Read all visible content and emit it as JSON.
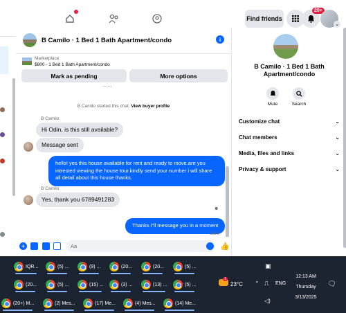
{
  "topnav": {
    "icons": [
      "home-icon",
      "friends-icon",
      "groups-icon"
    ],
    "find_friends": "Find friends",
    "notifications_badge": "20+"
  },
  "chat": {
    "title": "B Camilo · 1 Bed 1 Bath Apartment/condo",
    "marketplace": {
      "label": "Marketplace",
      "listing": "$800 - 1 Bed 1 Bath Apartment/condo",
      "mark_pending": "Mark as pending",
      "more_options": "More options"
    },
    "cut_off_text": "... ...",
    "system_line": "B Camilo started this chat.",
    "system_link": "View buyer profile",
    "messages": [
      {
        "sender": "B Camilo",
        "text": "Hi Odin, is this still available?"
      },
      {
        "sender": "",
        "text": "Message sent"
      },
      {
        "sender": "me",
        "text": "hello! yes this house available for rent and ready to move.are you intrested viewing the house tour.kindly send your number i will share all detail about this house thanks."
      },
      {
        "sender": "B Camilo",
        "text": "Yes, thank you 6789491283"
      },
      {
        "sender": "me",
        "text": "Thanks i\"ll message you in a moment"
      }
    ],
    "sent_status": "Sent",
    "composer_placeholder": "Aa"
  },
  "right_panel": {
    "title_line1": "B Camilo · 1 Bed 1 Bath",
    "title_line2": "Apartment/condo",
    "actions": [
      {
        "label": "Mute",
        "icon": "bell-icon"
      },
      {
        "label": "Search",
        "icon": "search-icon"
      }
    ],
    "sections": [
      "Customize chat",
      "Chat members",
      "Media, files and links",
      "Privacy & support"
    ]
  },
  "taskbar": {
    "row1": [
      "IQR...",
      "(5) ...",
      "(9) ...",
      "(20...",
      "(20...",
      "(5) ..."
    ],
    "row2": [
      "(20...",
      "(5) ...",
      "(15) ...",
      "(3) ...",
      "(13) ...",
      "(5) ..."
    ],
    "row3": [
      "(20+) M...",
      "(2) Mes...",
      "(17) Me...",
      "(4) Mes...",
      "(14) Me..."
    ],
    "weather": "23°C",
    "weather_badge": "1",
    "language": "ENG",
    "time": "12:13 AM",
    "day": "Thursday",
    "date": "3/13/2025"
  },
  "colors": {
    "accent": "#0866ff",
    "taskbar": "#1c2331",
    "bubble_in": "#e4e6eb"
  }
}
